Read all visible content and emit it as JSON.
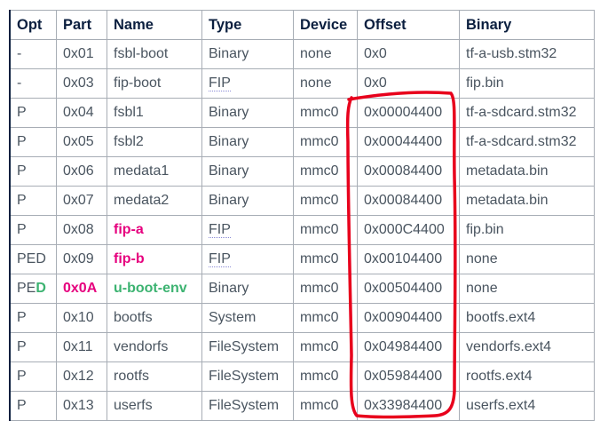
{
  "headers": [
    "Opt",
    "Part",
    "Name",
    "Type",
    "Device",
    "Offset",
    "Binary"
  ],
  "rows": [
    {
      "opt": "-",
      "part": "0x01",
      "name": "fsbl-boot",
      "type": "Binary",
      "device": "none",
      "offset": "0x0",
      "binary": "tf-a-usb.stm32"
    },
    {
      "opt": "-",
      "part": "0x03",
      "name": "fip-boot",
      "type": "FIP",
      "device": "none",
      "offset": "0x0",
      "binary": "fip.bin"
    },
    {
      "opt": "P",
      "part": "0x04",
      "name": "fsbl1",
      "type": "Binary",
      "device": "mmc0",
      "offset": "0x00004400",
      "binary": "tf-a-sdcard.stm32"
    },
    {
      "opt": "P",
      "part": "0x05",
      "name": "fsbl2",
      "type": "Binary",
      "device": "mmc0",
      "offset": "0x00044400",
      "binary": "tf-a-sdcard.stm32"
    },
    {
      "opt": "P",
      "part": "0x06",
      "name": "medata1",
      "type": "Binary",
      "device": "mmc0",
      "offset": "0x00084400",
      "binary": "metadata.bin"
    },
    {
      "opt": "P",
      "part": "0x07",
      "name": "medata2",
      "type": "Binary",
      "device": "mmc0",
      "offset": "0x00084400",
      "binary": "metadata.bin"
    },
    {
      "opt": "P",
      "part": "0x08",
      "name": "fip-a",
      "type": "FIP",
      "device": "mmc0",
      "offset": "0x000C4400",
      "binary": "fip.bin"
    },
    {
      "opt": "PED",
      "part": "0x09",
      "name": "fip-b",
      "type": "FIP",
      "device": "mmc0",
      "offset": "0x00104400",
      "binary": "none"
    },
    {
      "opt": "PE",
      "opt_d": "D",
      "part": "0x0A",
      "name": "u-boot-env",
      "type": "Binary",
      "device": "mmc0",
      "offset": "0x00504400",
      "binary": "none"
    },
    {
      "opt": "P",
      "part": "0x10",
      "name": "bootfs",
      "type": "System",
      "device": "mmc0",
      "offset": "0x00904400",
      "binary": "bootfs.ext4"
    },
    {
      "opt": "P",
      "part": "0x11",
      "name": "vendorfs",
      "type": "FileSystem",
      "device": "mmc0",
      "offset": "0x04984400",
      "binary": "vendorfs.ext4"
    },
    {
      "opt": "P",
      "part": "0x12",
      "name": "rootfs",
      "type": "FileSystem",
      "device": "mmc0",
      "offset": "0x05984400",
      "binary": "rootfs.ext4"
    },
    {
      "opt": "P",
      "part": "0x13",
      "name": "userfs",
      "type": "FileSystem",
      "device": "mmc0",
      "offset": "0x33984400",
      "binary": "userfs.ext4"
    }
  ],
  "colors": {
    "highlight_pink": "#e6007e",
    "highlight_green": "#3cb371",
    "annotation": "#e8001c"
  }
}
